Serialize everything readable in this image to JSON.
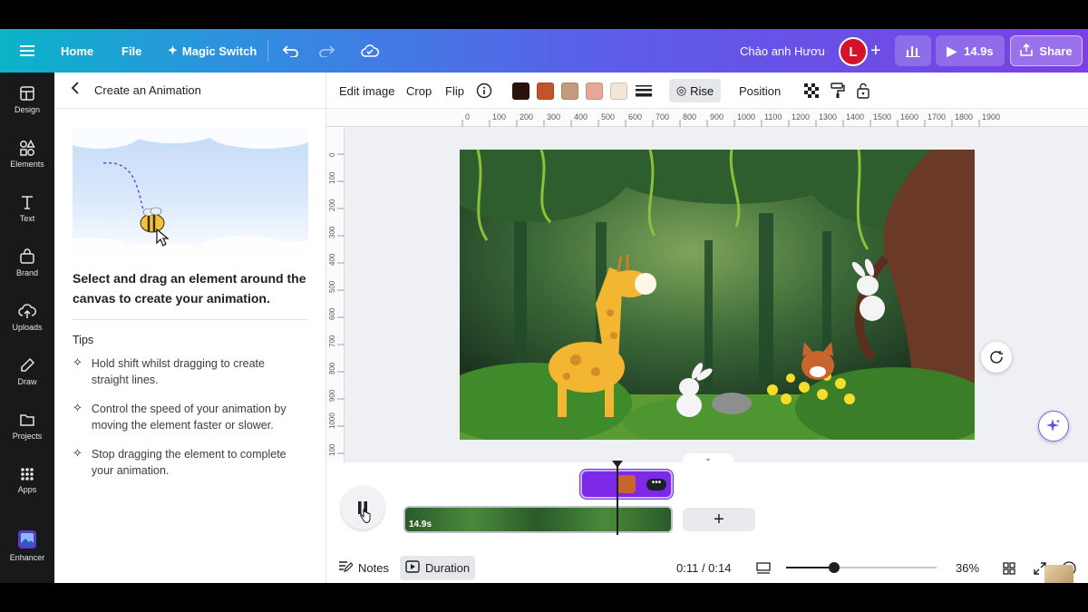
{
  "topbar": {
    "home_label": "Home",
    "file_label": "File",
    "magic_switch_label": "Magic Switch",
    "design_title": "Chào anh Hươu",
    "avatar_letter": "L",
    "play_duration": "14.9s",
    "share_label": "Share"
  },
  "rail": {
    "items": [
      {
        "label": "Design",
        "icon": "layout-icon"
      },
      {
        "label": "Elements",
        "icon": "shapes-icon"
      },
      {
        "label": "Text",
        "icon": "text-icon"
      },
      {
        "label": "Brand",
        "icon": "brand-icon"
      },
      {
        "label": "Uploads",
        "icon": "cloud-upload-icon"
      },
      {
        "label": "Draw",
        "icon": "pen-icon"
      },
      {
        "label": "Projects",
        "icon": "folder-icon"
      },
      {
        "label": "Apps",
        "icon": "apps-grid-icon"
      },
      {
        "label": "Enhancer",
        "icon": "enhancer-icon"
      }
    ]
  },
  "panel": {
    "title": "Create an Animation",
    "instruction": "Select and drag an element around the canvas to create your animation.",
    "tips_heading": "Tips",
    "tips": [
      "Hold shift whilst dragging to create straight lines.",
      "Control the speed of your animation by moving the element faster or slower.",
      "Stop dragging the element to complete your animation."
    ]
  },
  "toolbar": {
    "edit_image_label": "Edit image",
    "crop_label": "Crop",
    "flip_label": "Flip",
    "swatches": [
      "#2b120c",
      "#c3532b",
      "#c89a7c",
      "#e8a898",
      "#f3e6d6"
    ],
    "rise_label": "Rise",
    "position_label": "Position"
  },
  "ruler": {
    "h_ticks": [
      "0",
      "100",
      "200",
      "300",
      "400",
      "500",
      "600",
      "700",
      "800",
      "900",
      "1000",
      "1100",
      "1200",
      "1300",
      "1400",
      "1500",
      "1600",
      "1700",
      "1800",
      "1900"
    ],
    "v_ticks": [
      "0",
      "100",
      "200",
      "300",
      "400",
      "500",
      "600",
      "700",
      "800",
      "900",
      "1000",
      "100"
    ]
  },
  "timeline": {
    "clip_duration": "14.9s"
  },
  "footer": {
    "notes_label": "Notes",
    "duration_label": "Duration",
    "time_readout": "0:11 / 0:14",
    "zoom_level": "36%",
    "zoom_fraction": 0.32
  },
  "colors": {
    "accent": "#7d2ae8",
    "avatar_bg": "#d4122a",
    "rail_bg": "#18191b"
  }
}
